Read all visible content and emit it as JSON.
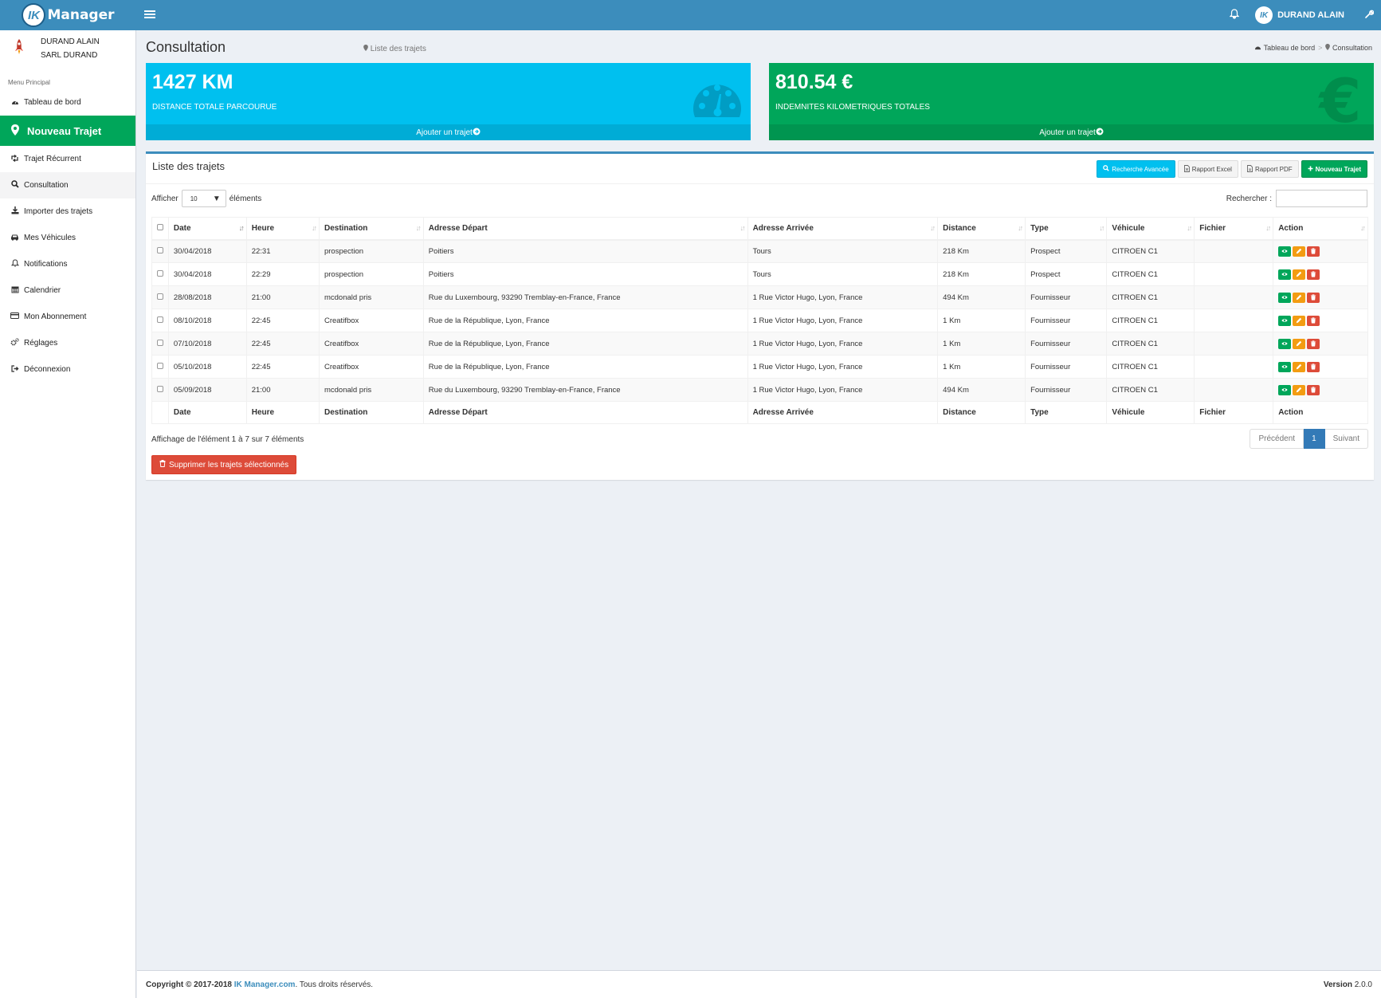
{
  "brand": {
    "logo_initials": "IK",
    "name": "Manager"
  },
  "header": {
    "user_initials": "IK",
    "user_name": "DURAND ALAIN"
  },
  "sidebar": {
    "user_line1": "DURAND ALAIN",
    "user_line2": "SARL DURAND",
    "menu_header": "Menu Principal",
    "items": [
      {
        "label": "Tableau de bord",
        "icon": "dashboard-icon"
      },
      {
        "label": "Nouveau Trajet",
        "icon": "map-marker-icon"
      },
      {
        "label": "Trajet Récurrent",
        "icon": "retweet-icon"
      },
      {
        "label": "Consultation",
        "icon": "search-icon"
      },
      {
        "label": "Importer des trajets",
        "icon": "download-icon"
      },
      {
        "label": "Mes Véhicules",
        "icon": "car-icon"
      },
      {
        "label": "Notifications",
        "icon": "bell-icon"
      },
      {
        "label": "Calendrier",
        "icon": "calendar-icon"
      },
      {
        "label": "Mon Abonnement",
        "icon": "credit-card-icon"
      },
      {
        "label": "Réglages",
        "icon": "cogs-icon"
      },
      {
        "label": "Déconnexion",
        "icon": "sign-out-icon"
      }
    ]
  },
  "page": {
    "title": "Consultation",
    "subtitle": "Liste des trajets",
    "breadcrumb_home": "Tableau de bord",
    "breadcrumb_current": "Consultation"
  },
  "stats": {
    "distance_value": "1427 KM",
    "distance_label": "DISTANCE TOTALE PARCOURUE",
    "distance_footer": "Ajouter un trajet",
    "indemnity_value": "810.54 €",
    "indemnity_label": "INDEMNITES KILOMETRIQUES TOTALES",
    "indemnity_footer": "Ajouter un trajet",
    "indemnity_icon_glyph": "€"
  },
  "table_box": {
    "title": "Liste des trajets",
    "btn_search": "Recherche Avancée",
    "btn_excel": "Rapport Excel",
    "btn_pdf": "Rapport PDF",
    "btn_new": "Nouveau Trajet",
    "show_label": "Afficher",
    "show_value": "10",
    "elements_label": "éléments",
    "search_label": "Rechercher :",
    "search_value": "",
    "columns": [
      "Date",
      "Heure",
      "Destination",
      "Adresse Départ",
      "Adresse Arrivée",
      "Distance",
      "Type",
      "Véhicule",
      "Fichier",
      "Action"
    ],
    "rows": [
      {
        "date": "30/04/2018",
        "heure": "22:31",
        "destination": "prospection",
        "depart": "Poitiers",
        "arrivee": "Tours",
        "distance": "218 Km",
        "type": "Prospect",
        "vehicule": "CITROEN C1",
        "fichier": ""
      },
      {
        "date": "30/04/2018",
        "heure": "22:29",
        "destination": "prospection",
        "depart": "Poitiers",
        "arrivee": "Tours",
        "distance": "218 Km",
        "type": "Prospect",
        "vehicule": "CITROEN C1",
        "fichier": ""
      },
      {
        "date": "28/08/2018",
        "heure": "21:00",
        "destination": "mcdonald pris",
        "depart": "Rue du Luxembourg, 93290 Tremblay-en-France, France",
        "arrivee": "1 Rue Victor Hugo, Lyon, France",
        "distance": "494 Km",
        "type": "Fournisseur",
        "vehicule": "CITROEN C1",
        "fichier": ""
      },
      {
        "date": "08/10/2018",
        "heure": "22:45",
        "destination": "Creatifbox",
        "depart": "Rue de la République, Lyon, France",
        "arrivee": "1 Rue Victor Hugo, Lyon, France",
        "distance": "1 Km",
        "type": "Fournisseur",
        "vehicule": "CITROEN C1",
        "fichier": ""
      },
      {
        "date": "07/10/2018",
        "heure": "22:45",
        "destination": "Creatifbox",
        "depart": "Rue de la République, Lyon, France",
        "arrivee": "1 Rue Victor Hugo, Lyon, France",
        "distance": "1 Km",
        "type": "Fournisseur",
        "vehicule": "CITROEN C1",
        "fichier": ""
      },
      {
        "date": "05/10/2018",
        "heure": "22:45",
        "destination": "Creatifbox",
        "depart": "Rue de la République, Lyon, France",
        "arrivee": "1 Rue Victor Hugo, Lyon, France",
        "distance": "1 Km",
        "type": "Fournisseur",
        "vehicule": "CITROEN C1",
        "fichier": ""
      },
      {
        "date": "05/09/2018",
        "heure": "21:00",
        "destination": "mcdonald pris",
        "depart": "Rue du Luxembourg, 93290 Tremblay-en-France, France",
        "arrivee": "1 Rue Victor Hugo, Lyon, France",
        "distance": "494 Km",
        "type": "Fournisseur",
        "vehicule": "CITROEN C1",
        "fichier": ""
      }
    ],
    "info": "Affichage de l'élément 1 à 7 sur 7 éléments",
    "pager_prev": "Précédent",
    "pager_current": "1",
    "pager_next": "Suivant",
    "delete_selected": "Supprimer les trajets sélectionnés"
  },
  "footer": {
    "copyright": "Copyright © 2017-2018",
    "link": "IK Manager.com",
    "rights": ". Tous droits réservés.",
    "version_label": "Version",
    "version_value": "2.0.0"
  },
  "colors": {
    "header": "#3c8dbc",
    "primary_green": "#00a65a",
    "aqua": "#00c0ef",
    "danger": "#dd4b39",
    "warning": "#f39c12",
    "background": "#ecf0f5"
  }
}
